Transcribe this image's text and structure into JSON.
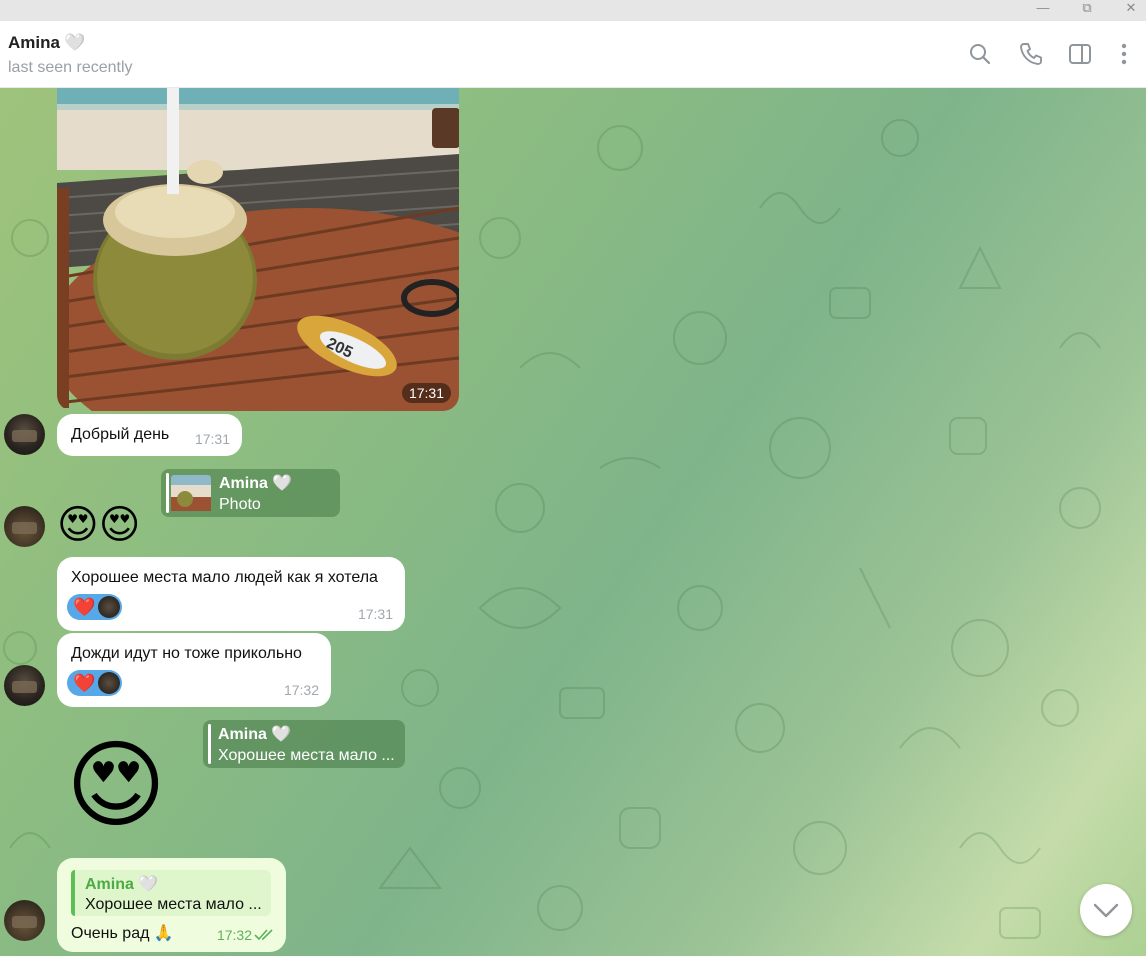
{
  "window": {
    "minimize_glyph": "—",
    "restore_glyph": "⧉",
    "close_glyph": "✕"
  },
  "header": {
    "name": "Amina",
    "name_heart": "🤍",
    "status": "last seen recently",
    "icons": [
      "search-icon",
      "phone-icon",
      "sidebar-toggle-icon",
      "more-vert-icon"
    ]
  },
  "messages": {
    "photo": {
      "time": "17:31"
    },
    "greeting": {
      "text": "Добрый день",
      "time": "17:31"
    },
    "reply1": {
      "name": "Amina",
      "name_heart": "🤍",
      "preview": "Photo"
    },
    "emoji1": "😍😍",
    "place": {
      "text": "Хорошее места мало людей как я  хотела",
      "time": "17:31",
      "reaction": "❤️"
    },
    "rain": {
      "text": "Дожди идут но тоже прикольно",
      "time": "17:32",
      "reaction": "❤️"
    },
    "reply2": {
      "name": "Amina",
      "name_heart": "🤍",
      "preview": "Хорошее места мало ..."
    },
    "emoji_big": "😍",
    "outgoing": {
      "quote_name": "Amina",
      "quote_heart": "🤍",
      "quote_text": "Хорошее места мало ...",
      "text": "Очень рад 🙏",
      "time": "17:32",
      "status": "read"
    }
  },
  "colors": {
    "accent_green": "#5cbf55",
    "outgoing_bubble": "#effdde",
    "reaction_pill": "#58a7e6"
  }
}
